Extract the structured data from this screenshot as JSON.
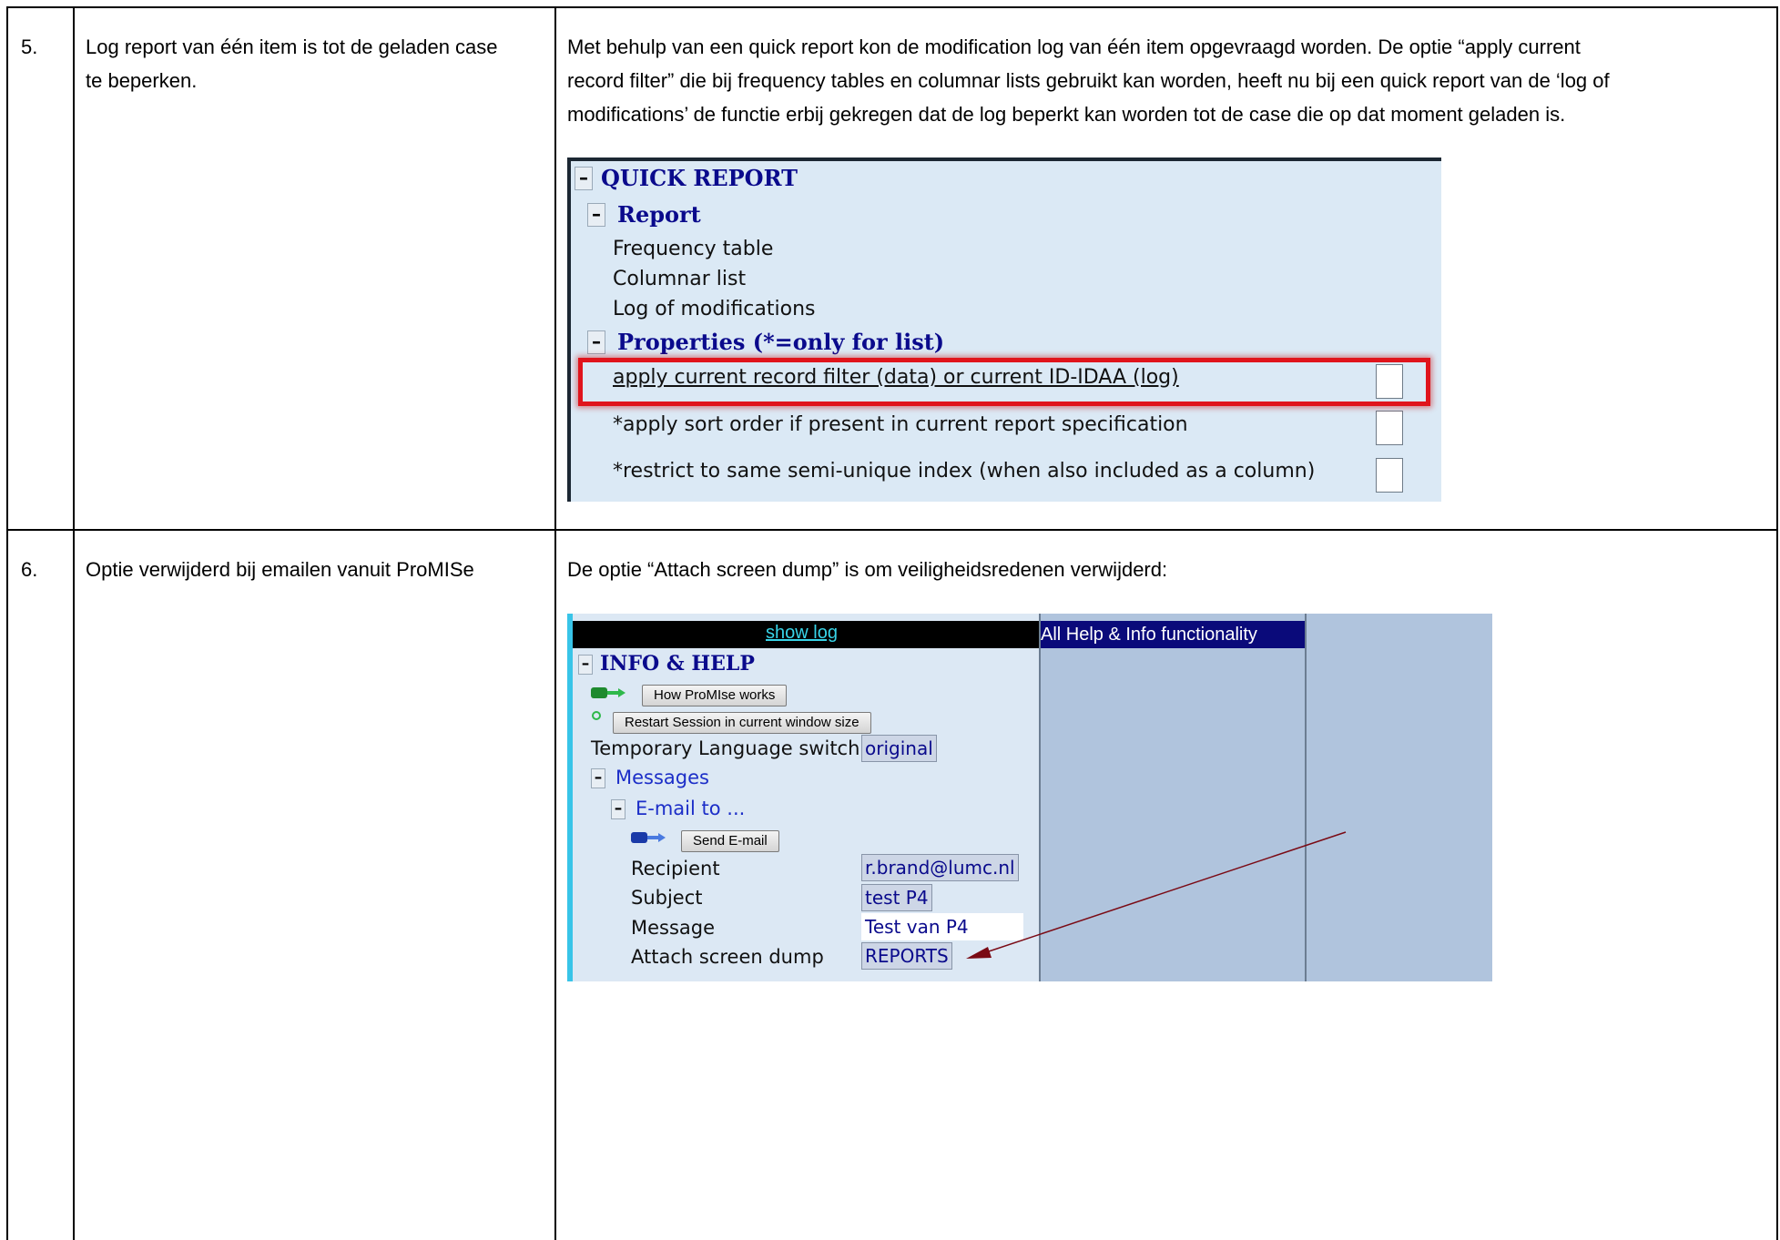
{
  "rows": [
    {
      "number": "5.",
      "title_lines": [
        "Log report van één item is tot de geladen case",
        "te beperken."
      ],
      "desc_lines": [
        "Met behulp van een quick report kon de modification log van één item opgevraagd worden. De optie “apply current",
        "record filter” die bij frequency tables en columnar lists gebruikt kan worden, heeft nu bij een quick report van de ‘log of",
        "modifications’ de functie erbij gekregen dat de log beperkt kan worden tot de case die op dat moment geladen is."
      ]
    },
    {
      "number": "6.",
      "title_lines": [
        "Optie verwijderd bij emailen vanuit ProMISe"
      ],
      "desc_lines": [
        "De optie “Attach screen dump” is om veiligheidsredenen verwijderd:"
      ]
    }
  ],
  "quick_report": {
    "title": "QUICK REPORT",
    "report_header": "Report",
    "report_items": [
      "Frequency table",
      "Columnar list",
      "Log of modifications"
    ],
    "properties_header": "Properties (*=only for list)",
    "properties": [
      "apply current record filter (data) or current ID-IDAA (log)",
      "*apply sort order if present in current report specification",
      "*restrict to same semi-unique index (when also included as a column)"
    ],
    "minus": "–",
    "highlight_color": "#e0141c"
  },
  "info_help": {
    "show_log": "show log",
    "all_help": "All Help & Info functionality",
    "title": "INFO & HELP",
    "how_button": "How ProMIse works",
    "restart_button": "Restart Session in current window size",
    "lang_label": "Temporary Language switch",
    "lang_value": "original",
    "messages": "Messages",
    "email_to": "E-mail to ...",
    "send_button": "Send E-mail",
    "fields": [
      {
        "label": "Recipient",
        "value": "r.brand@lumc.nl"
      },
      {
        "label": "Subject",
        "value": "test P4"
      },
      {
        "label": "Message",
        "value": "Test van P4"
      },
      {
        "label": "Attach screen dump",
        "value": "REPORTS"
      }
    ],
    "minus": "–",
    "arrow_color": "#7a0a14",
    "plug_icon": "plug-icon",
    "refresh_icon": "refresh-icon"
  }
}
